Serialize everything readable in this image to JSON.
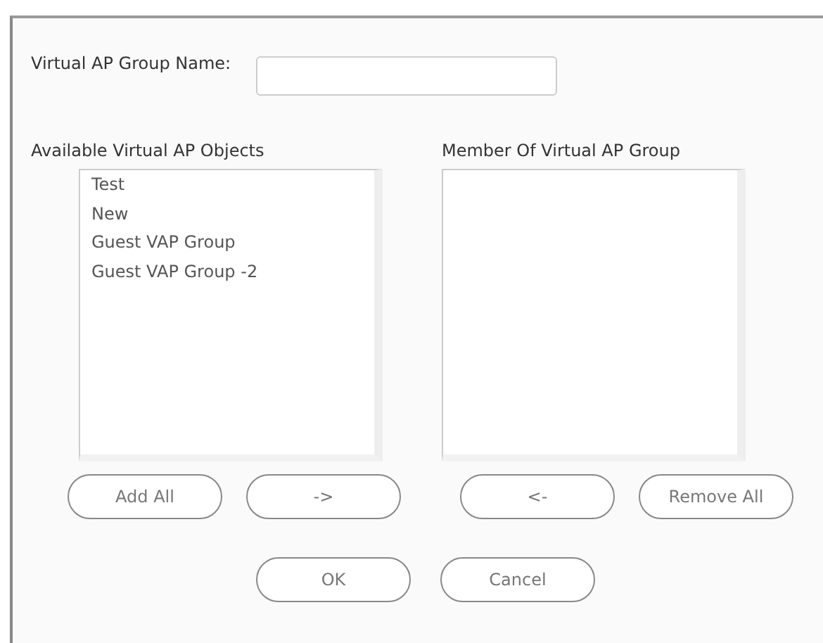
{
  "name_field": {
    "label": "Virtual AP Group Name:"
  },
  "available": {
    "heading": "Available Virtual AP Objects",
    "items": [
      "Test",
      "New",
      "Guest VAP Group",
      "Guest VAP Group -2"
    ]
  },
  "members": {
    "heading": "Member Of Virtual AP Group"
  },
  "list_buttons": [
    "Add All",
    "->",
    "<-",
    "Remove All"
  ],
  "dialog_buttons": [
    "OK",
    "Cancel"
  ]
}
